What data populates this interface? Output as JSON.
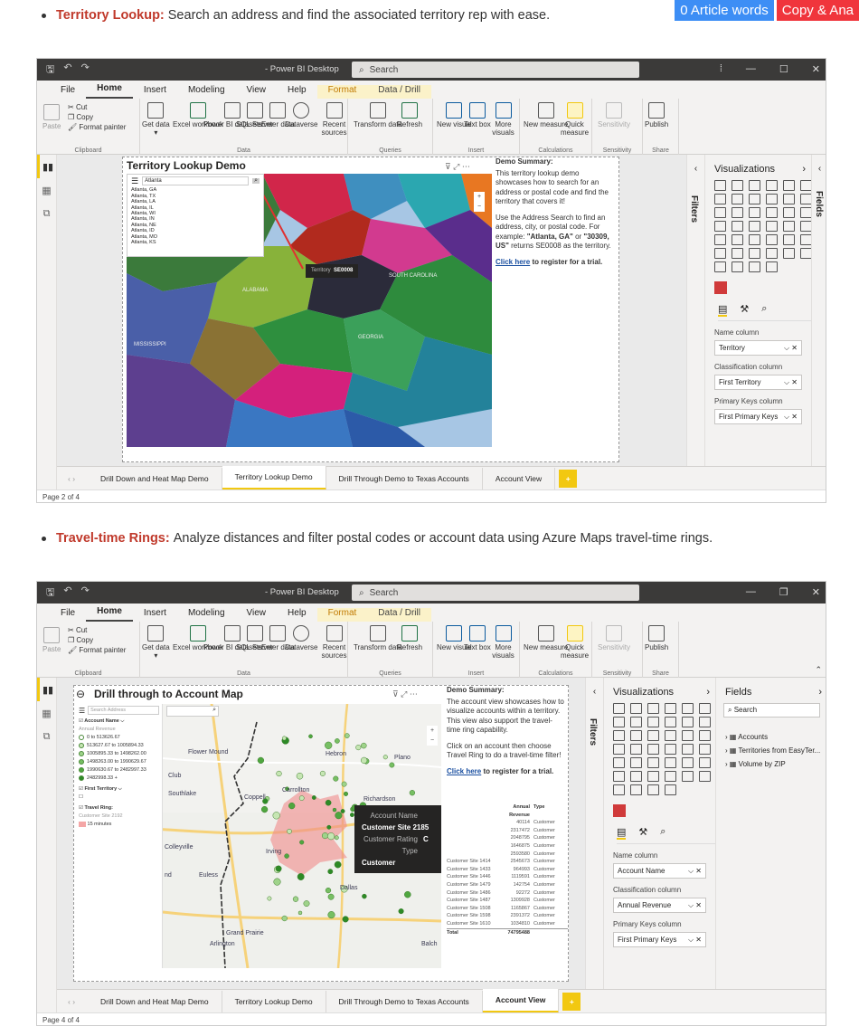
{
  "header_buttons": {
    "words": "0 Article words",
    "copy": "Copy & Ana"
  },
  "bullet1": {
    "label": "Territory Lookup:",
    "text": "Search an address and find the associated territory rep with ease."
  },
  "bullet2": {
    "label": "Travel-time Rings:",
    "text": "Analyze distances and filter postal codes or account data using Azure Maps travel-time rings."
  },
  "app": {
    "title": "- Power BI Desktop",
    "search": "Search",
    "menu": [
      "File",
      "Home",
      "Insert",
      "Modeling",
      "View",
      "Help",
      "Format",
      "Data / Drill"
    ],
    "clipboard": {
      "cut": "Cut",
      "copy": "Copy",
      "paste": "Paste",
      "painter": "Format painter",
      "group": "Clipboard"
    },
    "data_group": [
      "Get data",
      "Excel workbook",
      "Power BI datasets",
      "SQL Server",
      "Enter data",
      "Dataverse",
      "Recent sources"
    ],
    "groups": [
      "Clipboard",
      "Data",
      "Queries",
      "Insert",
      "Calculations",
      "Sensitivity",
      "Share"
    ],
    "queries": [
      "Transform data",
      "Refresh"
    ],
    "insert": [
      "New visual",
      "Text box",
      "More visuals"
    ],
    "calcs": [
      "New measure",
      "Quick measure"
    ],
    "sens": "Sensitivity",
    "publish": "Publish"
  },
  "shot1": {
    "report_title": "Territory Lookup Demo",
    "search_value": "Atlanta",
    "suggestions": [
      "Atlanta, GA",
      "Atlanta, TX",
      "Atlanta, LA",
      "Atlanta, IL",
      "Atlanta, WI",
      "Atlanta, IN",
      "Atlanta, NE",
      "Atlanta, ID",
      "Atlanta, MO",
      "Atlanta, KS"
    ],
    "tooltip": {
      "label": "Territory",
      "value": "SE0008"
    },
    "states": [
      "ALABAMA",
      "MISSISSIPPI",
      "GEORGIA",
      "SOUTH CAROLINA"
    ],
    "summary": {
      "title": "Demo Summary:",
      "p1": "This territory lookup demo showcases how to search for an address or postal code and find the territory that covers it!",
      "p2a": "Use the Address Search to find an address, city, or postal code. For example: ",
      "p2b": "\"Atlanta, GA\"",
      "p2c": " or ",
      "p2d": "\"30309, US\"",
      "p2e": " returns SE0008 as the territory.",
      "link": "Click here",
      "link_rest": " to register for a trial."
    },
    "pane": {
      "title": "Visualizations",
      "fields": [
        {
          "label": "Name column",
          "value": "Territory"
        },
        {
          "label": "Classification column",
          "value": "First Territory"
        },
        {
          "label": "Primary Keys column",
          "value": "First Primary Keys"
        }
      ]
    },
    "tabs": [
      "Drill Down and Heat Map Demo",
      "Territory Lookup Demo",
      "Drill Through Demo to Texas Accounts",
      "Account View"
    ],
    "page": "Page 2 of 4"
  },
  "shot2": {
    "report_title": "Drill through to Account Map",
    "search_placeholder": "Search Address",
    "legend_title": "Account Name",
    "legend_sub": "Annual Revenue",
    "legend_items": [
      "0 to 513626.67",
      "513627.67 to 1005894.33",
      "1005895.33 to 1498262.00",
      "1498263.00 to 1990629.67",
      "1990630.67 to 2482997.33",
      "2482998.33 +"
    ],
    "legend_territory": "First Territory",
    "legend_ring": "Travel Ring:",
    "legend_ring_sub": "Customer Site 2192",
    "legend_ring_val": "15 minutes",
    "cities": [
      "Flower Mound",
      "Carrollton",
      "Plano",
      "Richardson",
      "Irving",
      "Dallas",
      "Euless",
      "Arlington",
      "Grand Prairie",
      "Southlake",
      "Colleyville",
      "Coppell",
      "Hebron",
      "Club",
      "nd",
      "Balch"
    ],
    "tooltip": [
      {
        "k": "Account Name",
        "v": "Customer Site 2185"
      },
      {
        "k": "Customer Rating",
        "v": "C"
      },
      {
        "k": "Type",
        "v": "Customer"
      }
    ],
    "table_head": [
      "",
      "Annual Revenue",
      "Type"
    ],
    "table_rows": [
      [
        "",
        "40114",
        "Customer"
      ],
      [
        "",
        "2317472",
        "Customer"
      ],
      [
        "",
        "2048795",
        "Customer"
      ],
      [
        "",
        "1646875",
        "Customer"
      ],
      [
        "",
        "2593580",
        "Customer"
      ],
      [
        "Customer Site 1414",
        "2545673",
        "Customer"
      ],
      [
        "Customer Site 1433",
        "964993",
        "Customer"
      ],
      [
        "Customer Site 1446",
        "1119591",
        "Customer"
      ],
      [
        "Customer Site 1479",
        "142754",
        "Customer"
      ],
      [
        "Customer Site 1486",
        "92272",
        "Customer"
      ],
      [
        "Customer Site 1487",
        "1309928",
        "Customer"
      ],
      [
        "Customer Site 1508",
        "1165867",
        "Customer"
      ],
      [
        "Customer Site 1598",
        "2391372",
        "Customer"
      ],
      [
        "Customer Site 1610",
        "1034810",
        "Customer"
      ]
    ],
    "table_total": [
      "Total",
      "74795488",
      ""
    ],
    "summary": {
      "title": "Demo Summary:",
      "p1": "The account view showcases how to visualize accounts within a territory. This view also support the travel-time ring capability.",
      "p2": "Click on an account then choose Travel Ring to do a travel-time filter!",
      "link": "Click here",
      "link_rest": " to register for a trial."
    },
    "pane": {
      "title": "Visualizations",
      "fields": [
        {
          "label": "Name column",
          "value": "Account Name"
        },
        {
          "label": "Classification column",
          "value": "Annual Revenue"
        },
        {
          "label": "Primary Keys column",
          "value": "First Primary Keys"
        }
      ]
    },
    "fields_pane": {
      "title": "Fields",
      "search": "Search",
      "items": [
        "Accounts",
        "Territories from EasyTer...",
        "Volume by ZIP"
      ]
    },
    "tabs": [
      "Drill Down and Heat Map Demo",
      "Territory Lookup Demo",
      "Drill Through Demo to Texas Accounts",
      "Account View"
    ],
    "page": "Page 4 of 4"
  },
  "filters_label": "Filters",
  "fields_label": "Fields"
}
